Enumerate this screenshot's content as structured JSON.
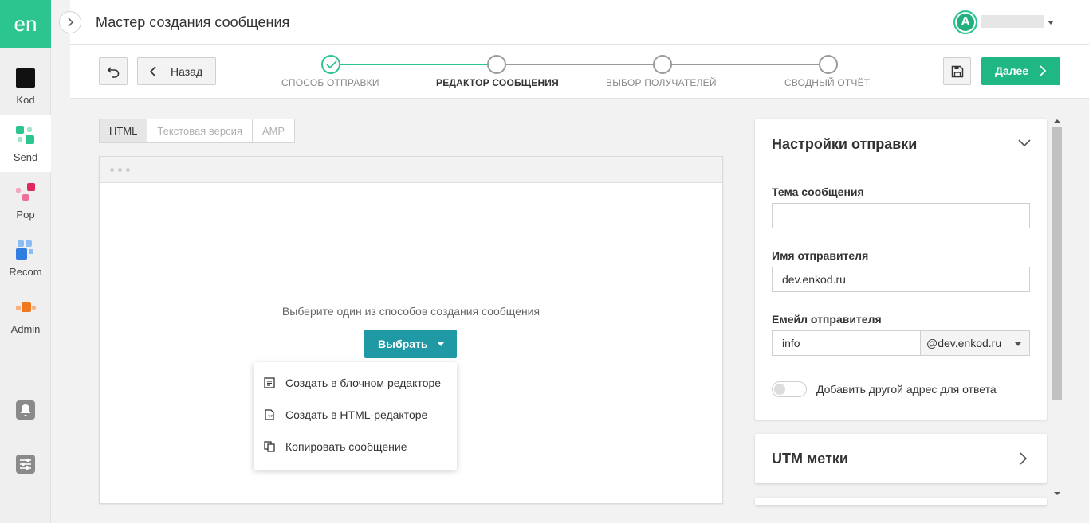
{
  "sidebar": {
    "logo": "en",
    "items": [
      {
        "label": "Kod",
        "icon": "kod-icon"
      },
      {
        "label": "Send",
        "icon": "send-icon"
      },
      {
        "label": "Pop",
        "icon": "pop-icon"
      },
      {
        "label": "Recom",
        "icon": "recom-icon"
      },
      {
        "label": "Admin",
        "icon": "admin-icon"
      }
    ],
    "bottom": [
      "bell-icon",
      "settings-sliders-icon"
    ]
  },
  "header": {
    "title": "Мастер создания сообщения",
    "avatar_letter": "A"
  },
  "toolbar": {
    "back_label": "Назад",
    "next_label": "Далее"
  },
  "steps": [
    {
      "label": "Способ отправки",
      "state": "done"
    },
    {
      "label": "Редактор сообщения",
      "state": "active"
    },
    {
      "label": "Выбор получателей",
      "state": "pending"
    },
    {
      "label": "Сводный отчёт",
      "state": "pending"
    }
  ],
  "editor": {
    "tabs": [
      "HTML",
      "Текстовая версия",
      "AMP"
    ],
    "active_tab": "HTML",
    "hint": "Выберите один из способов создания сообщения",
    "choose_label": "Выбрать",
    "menu": [
      {
        "label": "Создать в блочном редакторе",
        "icon": "block-editor-icon"
      },
      {
        "label": "Создать в HTML-редакторе",
        "icon": "html-file-icon"
      },
      {
        "label": "Копировать сообщение",
        "icon": "copy-icon"
      }
    ]
  },
  "settings": {
    "title": "Настройки отправки",
    "subject_label": "Тема сообщения",
    "subject_value": "",
    "sender_name_label": "Имя отправителя",
    "sender_name_value": "dev.enkod.ru",
    "sender_email_label": "Емейл отправителя",
    "sender_email_value": "info",
    "sender_domain": "@dev.enkod.ru",
    "reply_toggle_label": "Добавить другой адрес для ответа",
    "reply_toggle_on": false
  },
  "utm": {
    "title": "UTM метки"
  },
  "colors": {
    "brand": "#2cc58f",
    "primary_button": "#1fb884",
    "choose_button": "#1f9aa5"
  }
}
